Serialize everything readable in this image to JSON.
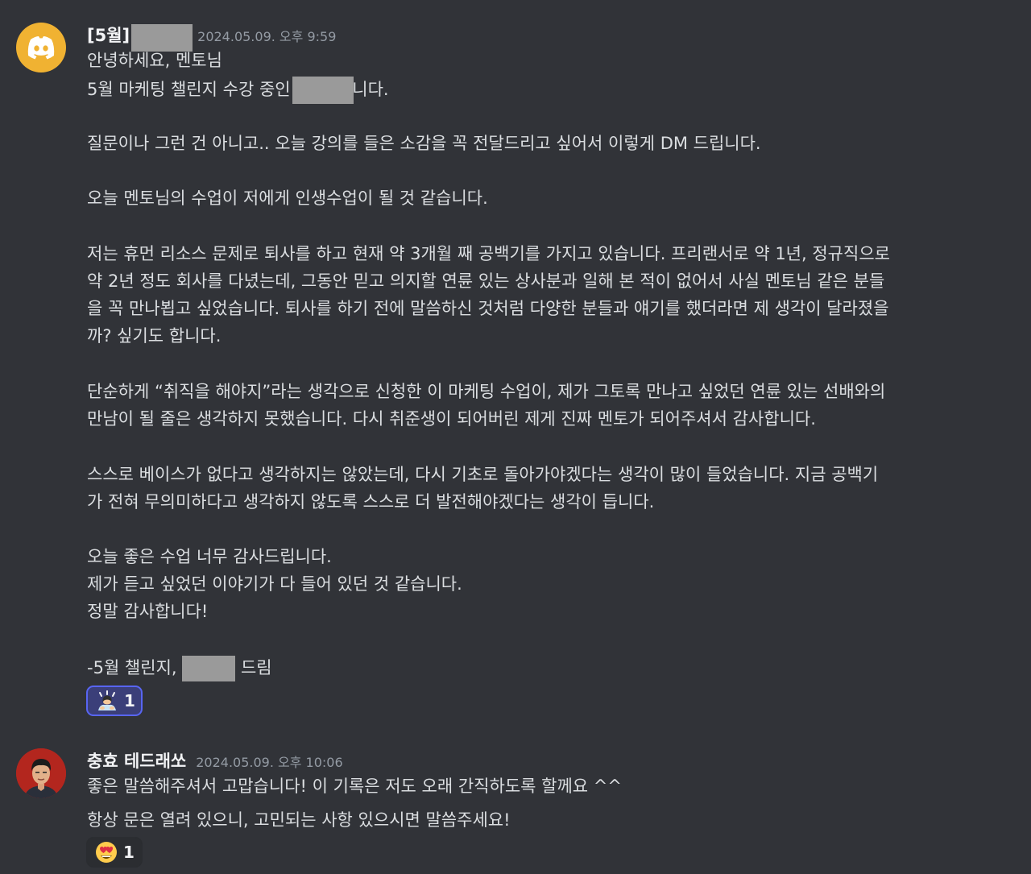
{
  "message1": {
    "author": "[5월]",
    "timestamp": "2024.05.09. 오후 9:59",
    "avatar_icon": "discord-logo-icon",
    "lines": [
      "안녕하세요, 멘토님",
      "5월 마케팅 챌린지 수강 중인",
      "니다.",
      "질문이나 그런 건 아니고.. 오늘 강의를 들은 소감을 꼭 전달드리고 싶어서 이렇게 DM 드립니다.",
      "오늘 멘토님의 수업이 저에게 인생수업이 될 것 같습니다.",
      "저는 휴먼 리소스 문제로 퇴사를 하고 현재 약 3개월 째 공백기를 가지고 있습니다. 프리랜서로 약 1년, 정규직으로",
      "약 2년 정도 회사를 다녔는데, 그동안 믿고 의지할 연륜 있는 상사분과 일해 본 적이 없어서 사실 멘토님 같은 분들",
      "을 꼭 만나뵙고 싶었습니다. 퇴사를 하기 전에 말씀하신 것처럼 다양한 분들과 얘기를 했더라면 제 생각이 달라졌을",
      "까? 싶기도 합니다.",
      "단순하게 “취직을 해야지”라는 생각으로 신청한 이 마케팅 수업이, 제가 그토록 만나고 싶었던 연륜 있는 선배와의",
      "만남이 될 줄은 생각하지 못했습니다. 다시 취준생이 되어버린 제게 진짜 멘토가 되어주셔서 감사합니다.",
      "스스로 베이스가 없다고 생각하지는 않았는데, 다시 기초로 돌아가야겠다는 생각이 많이 들었습니다. 지금 공백기",
      "가 전혀 무의미하다고 생각하지 않도록 스스로 더 발전해야겠다는 생각이 듭니다.",
      "오늘 좋은 수업 너무 감사드립니다.",
      "제가 듣고 싶었던 이야기가 다 들어 있던 것 같습니다.",
      "정말 감사합니다!",
      "-5월 챌린지,",
      "드림"
    ],
    "reaction": {
      "emoji": "person-bowing-emoji",
      "count": "1"
    }
  },
  "message2": {
    "author": "충효 테드래쏘",
    "timestamp": "2024.05.09. 오후 10:06",
    "avatar_icon": "user-photo-avatar",
    "lines": [
      "좋은 말씀해주셔서 고맙습니다! 이 기록은 저도 오래 간직하도록 할께요 ^^",
      "항상 문은 열려 있으니, 고민되는 사항 있으시면 말씀주세요!"
    ],
    "reaction": {
      "emoji": "heart-eyes-emoji",
      "count": "1"
    }
  },
  "colors": {
    "background": "#313338",
    "text": "#dbdee1",
    "timestamp": "#949ba4",
    "discord_avatar": "#f0b232",
    "reaction_active": "#3b3f79",
    "reaction_border": "#5865f2"
  }
}
